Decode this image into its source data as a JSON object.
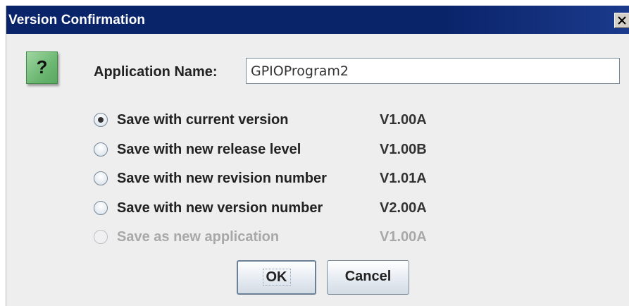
{
  "window": {
    "title": "Version Confirmation"
  },
  "dialog": {
    "icon": "question-mark-icon",
    "icon_glyph": "?",
    "app_name_label": "Application Name:",
    "app_name_value": "GPIOProgram2"
  },
  "options": [
    {
      "label": "Save with current version",
      "version": "V1.00A",
      "selected": true,
      "enabled": true
    },
    {
      "label": "Save with new release level",
      "version": "V1.00B",
      "selected": false,
      "enabled": true
    },
    {
      "label": "Save with new revision number",
      "version": "V1.01A",
      "selected": false,
      "enabled": true
    },
    {
      "label": "Save with new version number",
      "version": "V2.00A",
      "selected": false,
      "enabled": true
    },
    {
      "label": "Save as new application",
      "version": "V1.00A",
      "selected": false,
      "enabled": false
    }
  ],
  "buttons": {
    "ok_label": "OK",
    "cancel_label": "Cancel"
  },
  "colors": {
    "titlebar": "#0a246a",
    "dialog_bg": "#eeeeee",
    "icon_green": "#6cb772",
    "disabled_text": "#a8a8a8"
  }
}
